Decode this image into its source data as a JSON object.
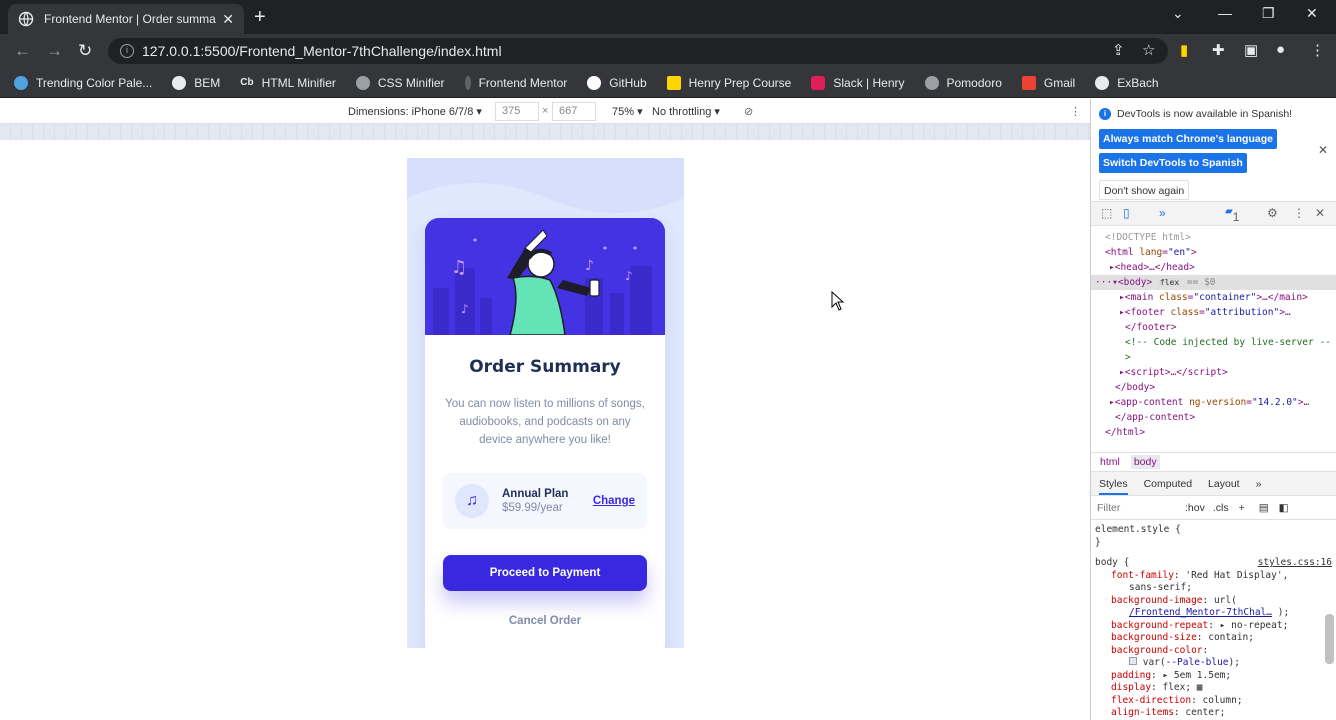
{
  "browser": {
    "tab_title": "Frontend Mentor | Order summa",
    "url": "127.0.0.1:5500/Frontend_Mentor-7thChallenge/index.html",
    "bookmarks": [
      {
        "label": "Trending Color Pale...",
        "color": "#4fa3e0"
      },
      {
        "label": "BEM",
        "color": "#e8eaed"
      },
      {
        "label": "HTML Minifier",
        "color": "#e8eaed"
      },
      {
        "label": "CSS Minifier",
        "color": "#9aa0a6"
      },
      {
        "label": "Frontend Mentor",
        "color": "#5f6368"
      },
      {
        "label": "GitHub",
        "color": "#ffffff"
      },
      {
        "label": "Henry Prep Course",
        "color": "#ffd400"
      },
      {
        "label": "Slack | Henry",
        "color": "#e01e5a"
      },
      {
        "label": "Pomodoro",
        "color": "#9aa0a6"
      },
      {
        "label": "Gmail",
        "color": "#ea4335"
      },
      {
        "label": "ExBach",
        "color": "#e8eaed"
      }
    ],
    "bookmark_prefix_cb": "Cb"
  },
  "device_toolbar": {
    "dimensions": "Dimensions: iPhone 6/7/8",
    "width": "375",
    "x": "×",
    "height": "667",
    "zoom": "75%",
    "throttling": "No throttling"
  },
  "order_card": {
    "title": "Order Summary",
    "description": "You can now listen to millions of songs, audiobooks, and podcasts on any device anywhere you like!",
    "plan_name": "Annual Plan",
    "plan_price": "$59.99/year",
    "change_label": "Change",
    "proceed_label": "Proceed to Payment",
    "cancel_label": "Cancel Order"
  },
  "devtools": {
    "notice": "DevTools is now available in Spanish!",
    "btn_match": "Always match Chrome's language",
    "btn_switch": "Switch DevTools to Spanish",
    "btn_dont": "Don't show again",
    "issues_count": "1",
    "crumbs": [
      "html",
      "body"
    ],
    "style_tabs": [
      "Styles",
      "Computed",
      "Layout"
    ],
    "filter_placeholder": "Filter",
    "hov": ":hov",
    "cls": ".cls",
    "element_style": "element.style {",
    "close_brace": "}",
    "body_selector": "body {",
    "stylesheet_link": "styles.css:16",
    "accent": "#1a73e8"
  }
}
